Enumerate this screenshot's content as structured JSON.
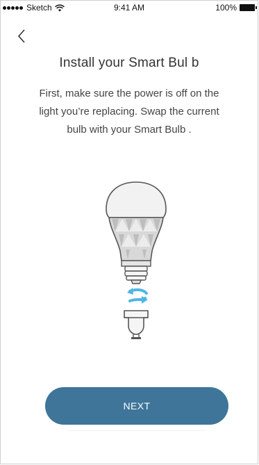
{
  "status_bar": {
    "carrier": "Sketch",
    "time": "9:41 AM",
    "battery": "100%"
  },
  "nav": {
    "back_icon": "chevron-left-icon"
  },
  "title": "Install your Smart Bul b",
  "description": "First, make sure the power is off on the light you’re replacing. Swap the current bulb with your Smart Bulb .",
  "illustration": {
    "icon": "smart-bulb-install-illustration",
    "bulb_color": "#f2f2f2",
    "arrow_color": "#4fb6e6"
  },
  "next_button": {
    "label": "NEXT",
    "color": "#3e7599"
  }
}
